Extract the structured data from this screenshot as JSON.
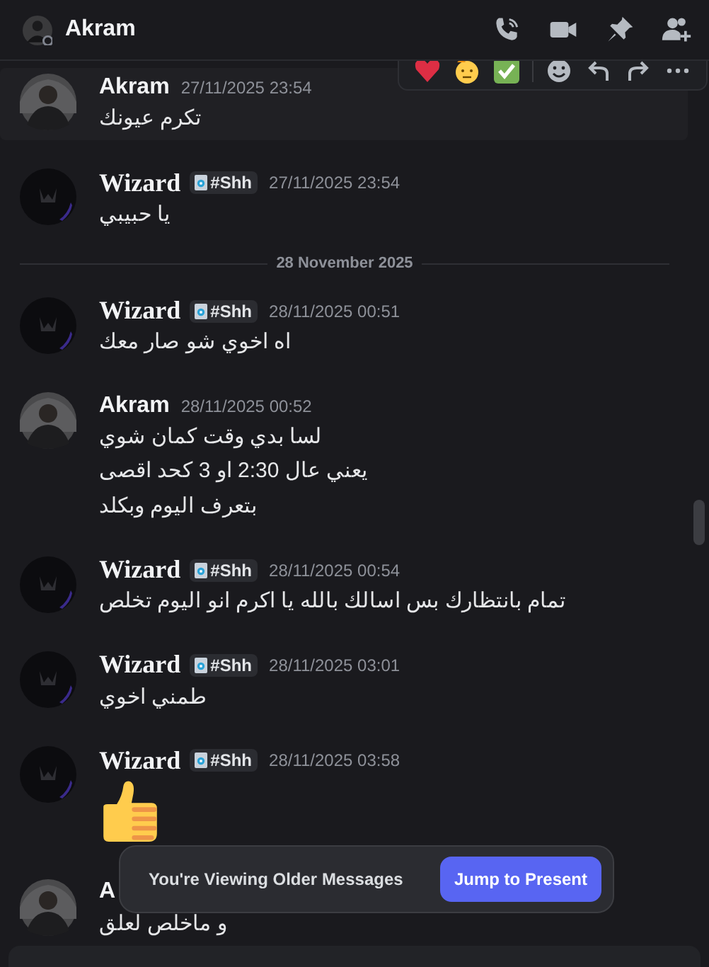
{
  "header": {
    "title": "Akram"
  },
  "messages": [
    {
      "kind": "photo",
      "author": "Akram",
      "time": "27/11/2025 23:54",
      "hovered": true,
      "lines": [
        "تكرم عيونك"
      ]
    },
    {
      "kind": "emblem",
      "author": "Wizard",
      "tag": "#Shh",
      "time": "27/11/2025 23:54",
      "hovered": false,
      "lines": [
        "يا حبيبي"
      ]
    },
    {
      "divider": "28 November 2025"
    },
    {
      "kind": "emblem",
      "author": "Wizard",
      "tag": "#Shh",
      "time": "28/11/2025 00:51",
      "hovered": false,
      "lines": [
        "اه اخوي شو صار معك"
      ]
    },
    {
      "kind": "photo",
      "author": "Akram",
      "time": "28/11/2025 00:52",
      "hovered": false,
      "lines": [
        "لسا بدي وقت كمان شوي",
        "يعني عال 2:30 او 3 كحد اقصى",
        "بتعرف اليوم وبكلد"
      ]
    },
    {
      "kind": "emblem",
      "author": "Wizard",
      "tag": "#Shh",
      "time": "28/11/2025 00:54",
      "hovered": false,
      "lines": [
        "تمام بانتظارك بس اسالك بالله يا اكرم انو اليوم تخلص"
      ]
    },
    {
      "kind": "emblem",
      "author": "Wizard",
      "tag": "#Shh",
      "time": "28/11/2025 03:01",
      "hovered": false,
      "lines": [
        "طمني اخوي"
      ]
    },
    {
      "kind": "emblem",
      "author": "Wizard",
      "tag": "#Shh",
      "time": "28/11/2025 03:58",
      "hovered": false,
      "thumbs_up": true
    },
    {
      "kind": "photo",
      "author": "A",
      "hovered": false,
      "lines": [
        "و ماخلص لعلق"
      ]
    }
  ],
  "older_banner": {
    "text": "You're Viewing Older Messages",
    "button": "Jump to Present"
  }
}
